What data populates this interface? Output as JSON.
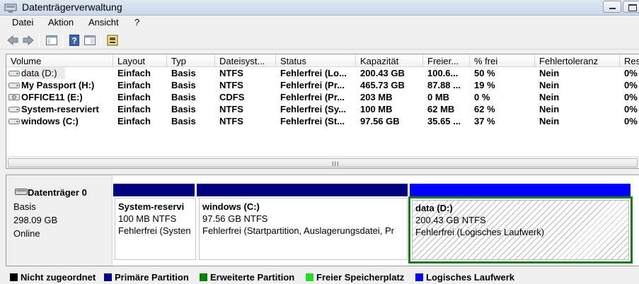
{
  "window": {
    "title": "Datenträgerverwaltung"
  },
  "menu": [
    "Datei",
    "Aktion",
    "Ansicht",
    "?"
  ],
  "toolbar_icons": [
    "back-arrow-icon",
    "forward-arrow-icon",
    "console-tree-icon",
    "help-icon",
    "properties-icon",
    "disk-management-icon"
  ],
  "columns": [
    "Volume",
    "Layout",
    "Typ",
    "Dateisyst...",
    "Status",
    "Kapazität",
    "Freier...",
    "% frei",
    "Fehlertoleranz",
    "Res"
  ],
  "volumes": [
    {
      "name": "data (D:)",
      "layout": "Einfach",
      "typ": "Basis",
      "fs": "NTFS",
      "status": "Fehlerfrei (Lo...",
      "cap": "200.43 GB",
      "free": "100.6...",
      "pct": "50 %",
      "ft": "Nein",
      "res": "0%",
      "icon": "drive-icon",
      "selected": true
    },
    {
      "name": "My Passport (H:)",
      "layout": "Einfach",
      "typ": "Basis",
      "fs": "NTFS",
      "status": "Fehlerfrei (Pr...",
      "cap": "465.73 GB",
      "free": "87.88 ...",
      "pct": "19 %",
      "ft": "Nein",
      "res": "0%",
      "icon": "drive-icon",
      "selected": false
    },
    {
      "name": "OFFICE11 (E:)",
      "layout": "Einfach",
      "typ": "Basis",
      "fs": "CDFS",
      "status": "Fehlerfrei (Pr...",
      "cap": "203 MB",
      "free": "0 MB",
      "pct": "0 %",
      "ft": "Nein",
      "res": "0%",
      "icon": "cd-drive-icon",
      "selected": false
    },
    {
      "name": "System-reserviert",
      "layout": "Einfach",
      "typ": "Basis",
      "fs": "NTFS",
      "status": "Fehlerfrei (Sy...",
      "cap": "100 MB",
      "free": "62 MB",
      "pct": "62 %",
      "ft": "Nein",
      "res": "0%",
      "icon": "drive-icon",
      "selected": false
    },
    {
      "name": "windows (C:)",
      "layout": "Einfach",
      "typ": "Basis",
      "fs": "NTFS",
      "status": "Fehlerfrei (St...",
      "cap": "97.56 GB",
      "free": "35.65 ...",
      "pct": "37 %",
      "ft": "Nein",
      "res": "0%",
      "icon": "drive-icon",
      "selected": false
    }
  ],
  "scrollbar_grip": "III",
  "disk": {
    "name": "Datenträger 0",
    "type": "Basis",
    "size": "298.09 GB",
    "state": "Online"
  },
  "partitions": [
    {
      "name": "System-reservi",
      "size": "100 MB NTFS",
      "status": "Fehlerfrei (Systen",
      "kind": "primary"
    },
    {
      "name": "windows  (C:)",
      "size": "97.56 GB NTFS",
      "status": "Fehlerfrei (Startpartition, Auslagerungsdatei, Pr",
      "kind": "primary"
    },
    {
      "name": "data  (D:)",
      "size": "200.43 GB NTFS",
      "status": "Fehlerfrei (Logisches Laufwerk)",
      "kind": "logical"
    }
  ],
  "legend": [
    {
      "label": "Nicht zugeordnet",
      "color": "#000000"
    },
    {
      "label": "Primäre Partition",
      "color": "#000080"
    },
    {
      "label": "Erweiterte Partition",
      "color": "#008000"
    },
    {
      "label": "Freier Speicherplatz",
      "color": "#22dd22"
    },
    {
      "label": "Logisches Laufwerk",
      "color": "#0000ff"
    }
  ],
  "colors": {
    "primary": "#000080",
    "logical": "#0000ff",
    "extended_border": "#1b7b1b"
  }
}
